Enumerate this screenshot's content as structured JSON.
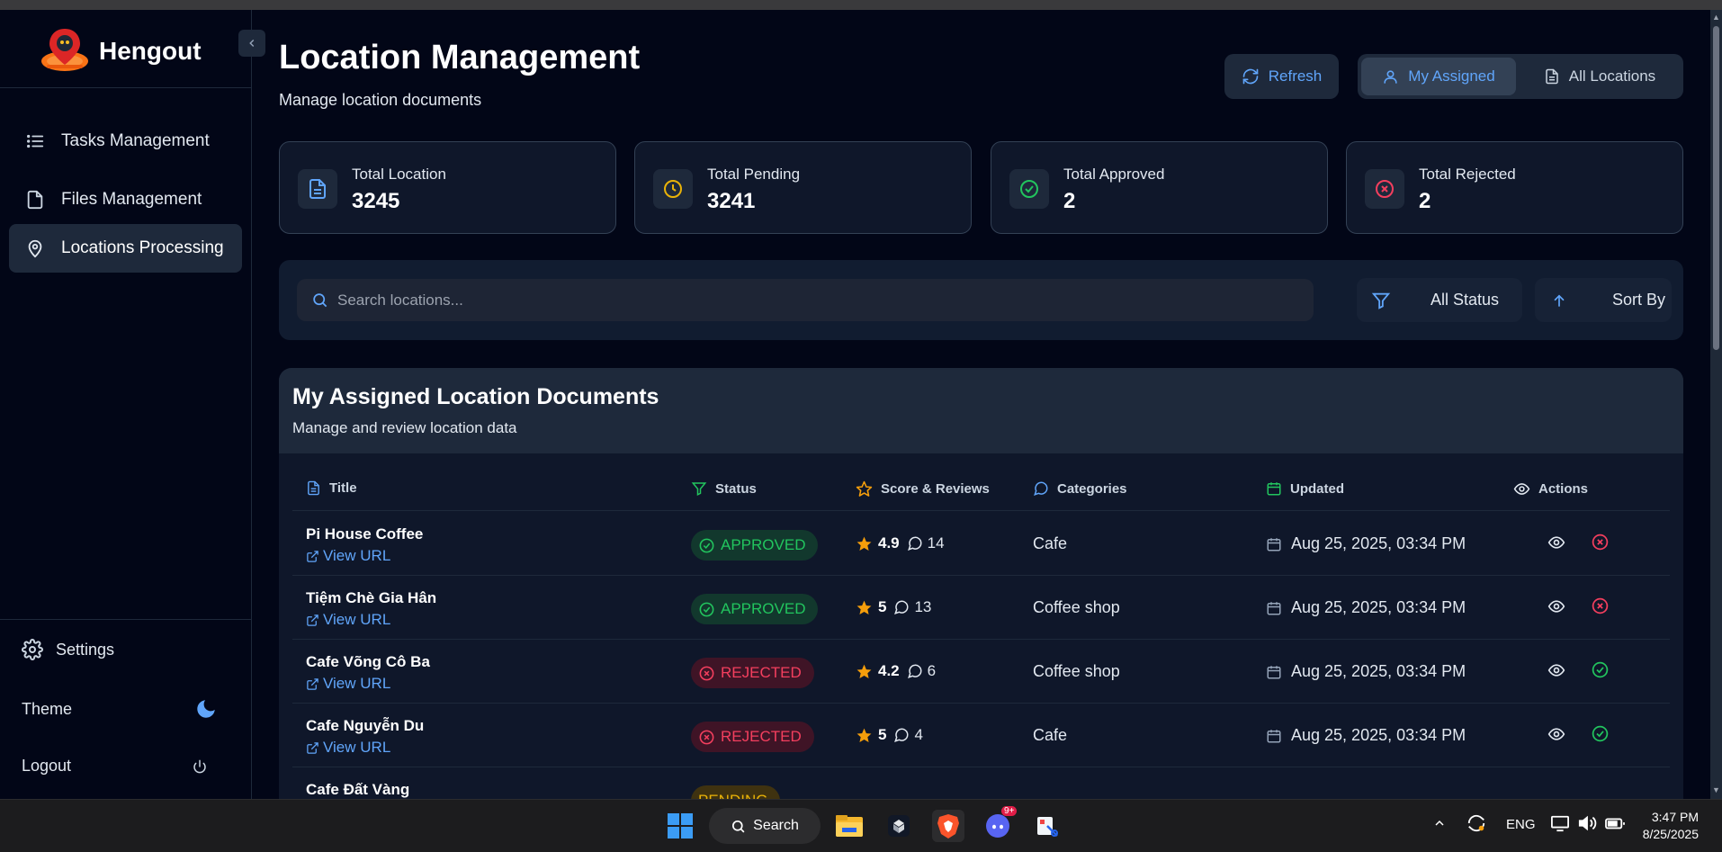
{
  "app": {
    "brand": "Hengout",
    "page_title": "Location Management",
    "page_subtitle": "Manage location documents"
  },
  "sidebar": {
    "items": [
      {
        "label": "Tasks Management",
        "icon": "list-icon",
        "active": false
      },
      {
        "label": "Files Management",
        "icon": "file-icon",
        "active": false
      },
      {
        "label": "Locations Processing",
        "icon": "map-pin-icon",
        "active": true
      }
    ],
    "settings_label": "Settings",
    "theme_label": "Theme",
    "logout_label": "Logout"
  },
  "header": {
    "refresh_label": "Refresh",
    "my_assigned_label": "My Assigned",
    "all_locations_label": "All Locations"
  },
  "stats": [
    {
      "label": "Total Location",
      "value": "3245",
      "icon": "document-icon",
      "color": "#60a5fa"
    },
    {
      "label": "Total Pending",
      "value": "3241",
      "icon": "clock-icon",
      "color": "#eab308"
    },
    {
      "label": "Total Approved",
      "value": "2",
      "icon": "check-circle-icon",
      "color": "#22c55e"
    },
    {
      "label": "Total Rejected",
      "value": "2",
      "icon": "x-circle-icon",
      "color": "#f43f5e"
    }
  ],
  "filters": {
    "search_placeholder": "Search locations...",
    "status_label": "All Status",
    "sort_label": "Sort By"
  },
  "table": {
    "title": "My Assigned Location Documents",
    "subtitle": "Manage and review location data",
    "columns": [
      "Title",
      "Status",
      "Score & Reviews",
      "Categories",
      "Updated",
      "Actions"
    ],
    "view_url_label": "View URL",
    "rows": [
      {
        "title": "Pi House Coffee",
        "status": "APPROVED",
        "score": "4.9",
        "reviews": "14",
        "category": "Cafe",
        "updated": "Aug 25, 2025, 03:34 PM"
      },
      {
        "title": "Tiệm Chè Gia Hân",
        "status": "APPROVED",
        "score": "5",
        "reviews": "13",
        "category": "Coffee shop",
        "updated": "Aug 25, 2025, 03:34 PM"
      },
      {
        "title": "Cafe Võng Cô Ba",
        "status": "REJECTED",
        "score": "4.2",
        "reviews": "6",
        "category": "Coffee shop",
        "updated": "Aug 25, 2025, 03:34 PM"
      },
      {
        "title": "Cafe Nguyễn Du",
        "status": "REJECTED",
        "score": "5",
        "reviews": "4",
        "category": "Cafe",
        "updated": "Aug 25, 2025, 03:34 PM"
      },
      {
        "title": "Cafe Đất Vàng",
        "status": "PENDING",
        "score": "",
        "reviews": "",
        "category": "",
        "updated": ""
      }
    ]
  },
  "taskbar": {
    "search_label": "Search",
    "discord_badge": "9+",
    "lang": "ENG",
    "time": "3:47 PM",
    "date": "8/25/2025"
  },
  "colors": {
    "accent": "#60a5fa",
    "approved": "#22c55e",
    "rejected": "#f43f5e",
    "pending": "#eab308",
    "background": "#020617"
  }
}
